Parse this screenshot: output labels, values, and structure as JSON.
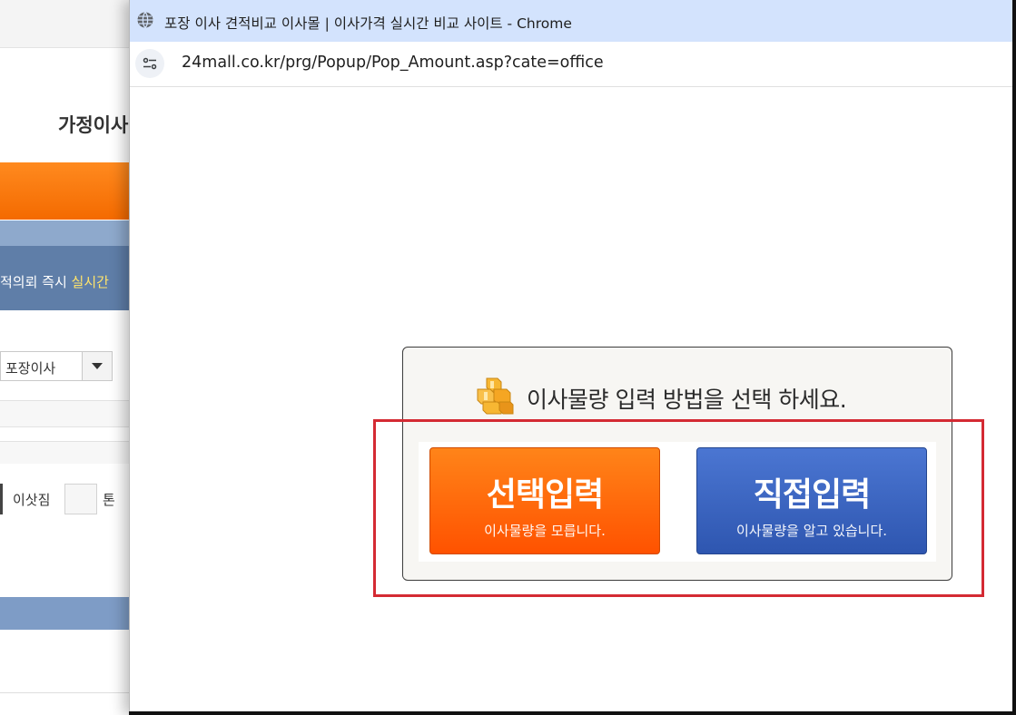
{
  "background_page": {
    "heading": "가정이사",
    "notice_text": "적의뢰 즉시 ",
    "notice_highlight": "실시간",
    "select_value": "포장이사",
    "cargo_label": "이삿짐",
    "cargo_unit": "톤"
  },
  "window": {
    "title": "포장 이사 견적비교 이사몰 | 이사가격 실시간 비교 사이트 - Chrome",
    "url": "24mall.co.kr/prg/Popup/Pop_Amount.asp?cate=office"
  },
  "dialog": {
    "title": "이사물량 입력 방법을 선택 하세요.",
    "options": [
      {
        "label": "선택입력",
        "sub": "이사물량을 모릅니다.",
        "color": "#ff6a0a"
      },
      {
        "label": "직접입력",
        "sub": "이사물량을 알고 있습니다.",
        "color": "#3a63c0"
      }
    ]
  },
  "colors": {
    "titlebar": "#d3e3fd",
    "highlight": "#d42a33"
  }
}
